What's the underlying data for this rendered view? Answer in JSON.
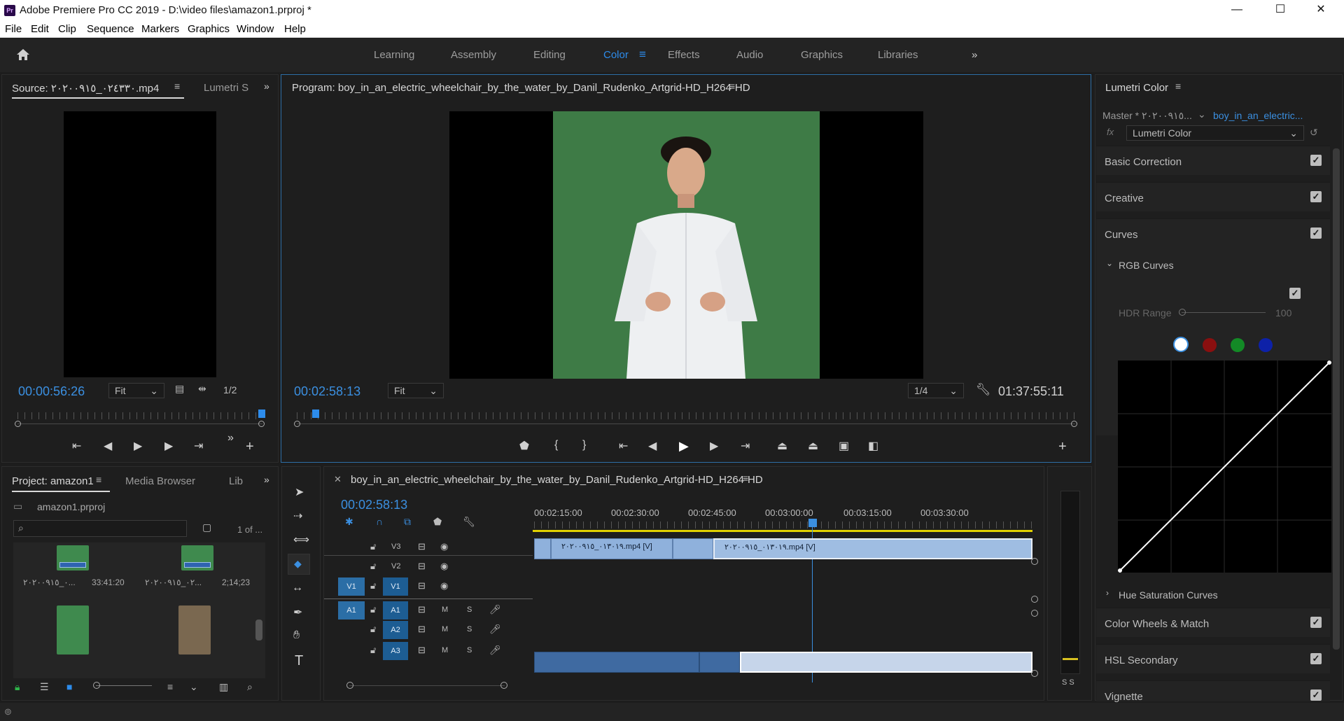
{
  "window": {
    "title": "Adobe Premiere Pro CC 2019 - D:\\video files\\amazon1.prproj *",
    "app_badge": "Pr",
    "controls": [
      "—",
      "☐",
      "✕"
    ]
  },
  "menu": [
    "File",
    "Edit",
    "Clip",
    "Sequence",
    "Markers",
    "Graphics",
    "Window",
    "Help"
  ],
  "workspace": {
    "tabs": [
      "Learning",
      "Assembly",
      "Editing",
      "Color",
      "Effects",
      "Audio",
      "Graphics",
      "Libraries"
    ],
    "active": "Color",
    "more": "»"
  },
  "source": {
    "tab_label": "Source: ٠٢٤٣٣٠_٢٠٢٠٠٩١٥.mp4",
    "tab2_label": "Lumetri S",
    "timecode": "00:00:56:26",
    "fit": "Fit",
    "resolution": "1/2"
  },
  "program": {
    "tab_label": "Program: boy_in_an_electric_wheelchair_by_the_water_by_Danil_Rudenko_Artgrid-HD_H264-HD",
    "timecode": "00:02:58:13",
    "fit": "Fit",
    "resolution": "1/4",
    "duration": "01:37:55:11"
  },
  "project": {
    "tab_label": "Project: amazon1",
    "tab2": "Media Browser",
    "tab3": "Lib",
    "file": "amazon1.prproj",
    "count": "1 of ...",
    "items": [
      {
        "name": "٠_٢٠٢٠٠٩١٥...",
        "duration": "33:41:20"
      },
      {
        "name": "٠٢_٢٠٢٠٠٩١٥...",
        "duration": "2;14;23"
      }
    ]
  },
  "timeline": {
    "sequence_name": "boy_in_an_electric_wheelchair_by_the_water_by_Danil_Rudenko_Artgrid-HD_H264-HD",
    "timecode": "00:02:58:13",
    "ruler": [
      "00:02:15:00",
      "00:02:30:00",
      "00:02:45:00",
      "00:03:00:00",
      "00:03:15:00",
      "00:03:30:00"
    ],
    "tracks": {
      "v3": "V3",
      "v2": "V2",
      "v1": "V1",
      "v1_src": "V1",
      "a1": "A1",
      "a1_src": "A1",
      "a2": "A2",
      "a3": "A3",
      "m": "M",
      "s": "S"
    },
    "clips": {
      "v3a": "٠١٣٠١٩_٢٠٢٠٠٩١٥.mp4 [V]",
      "v3b": "٠١٣٠١٩_٢٠٢٠٠٩١٥.mp4 [V]"
    },
    "audio_meter": "S S"
  },
  "lumetri": {
    "panel_title": "Lumetri Color",
    "master": "Master * ٢٠٢٠٠٩١٥...",
    "clip": "boy_in_an_electric...",
    "effect": "Lumetri Color",
    "sections": [
      "Basic Correction",
      "Creative",
      "Curves"
    ],
    "rgb_curves": "RGB Curves",
    "hdr_range": "HDR Range",
    "hdr_value": "100",
    "hue_sat": "Hue Saturation Curves",
    "lower_sections": [
      "Color Wheels & Match",
      "HSL Secondary",
      "Vignette"
    ]
  },
  "colors": {
    "accent": "#2d8ceb",
    "timecode": "#3b8fe0",
    "green_screen": "#3e7b46",
    "playhead": "#3b8fe0"
  }
}
